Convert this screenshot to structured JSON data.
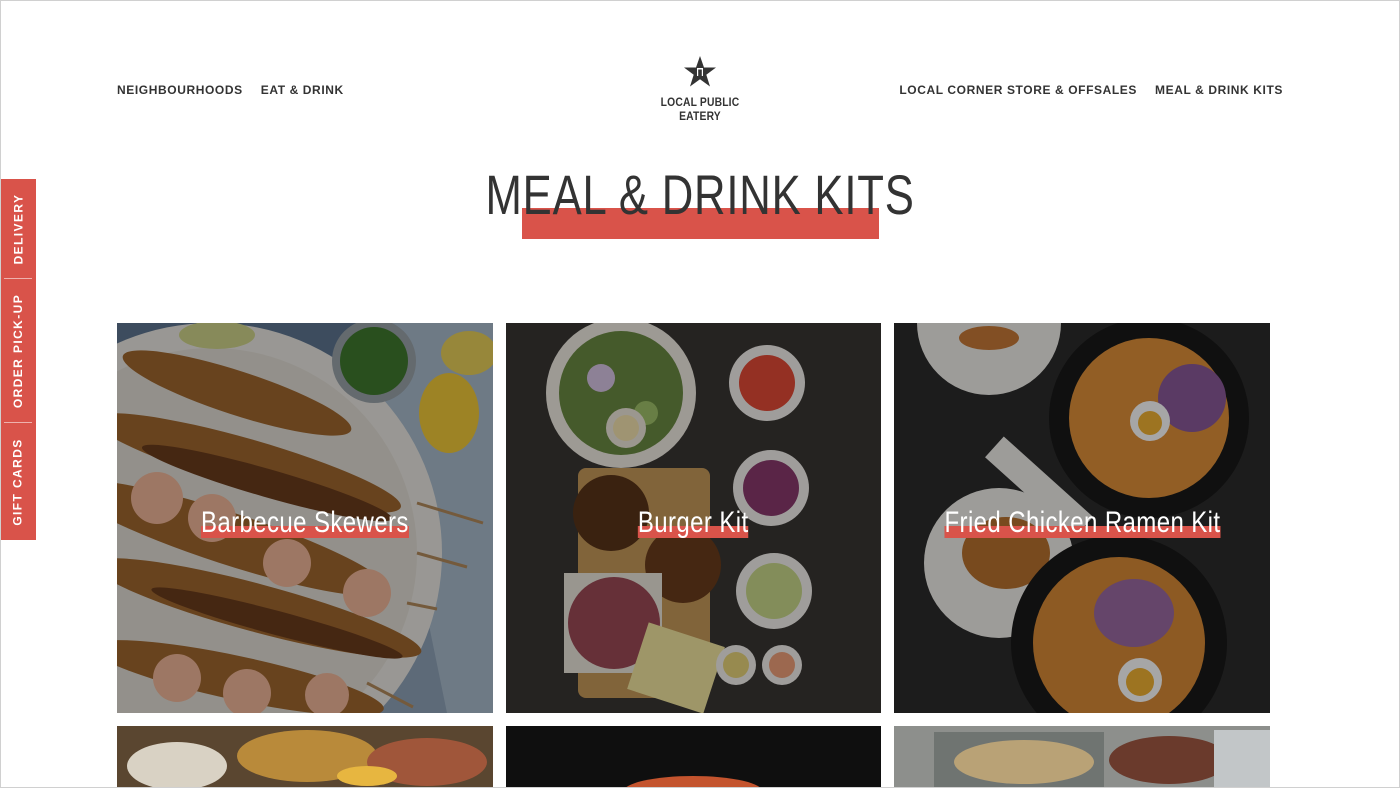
{
  "nav": {
    "left": [
      "NEIGHBOURHOODS",
      "EAT & DRINK"
    ],
    "right": [
      "LOCAL CORNER STORE & OFFSALES",
      "MEAL & DRINK KITS"
    ]
  },
  "logo": {
    "text": "LOCAL PUBLIC EATERY",
    "icon": "star-icon"
  },
  "page_title": "MEAL & DRINK KITS",
  "side_tabs": [
    "DELIVERY",
    "ORDER PICK-UP",
    "GIFT CARDS"
  ],
  "kits": [
    {
      "label": "Barbecue Skewers"
    },
    {
      "label": "Burger Kit"
    },
    {
      "label": "Fried Chicken Ramen Kit"
    }
  ],
  "colors": {
    "accent": "#d9534a",
    "text": "#333333",
    "background": "#ffffff"
  }
}
